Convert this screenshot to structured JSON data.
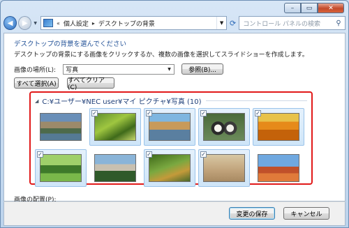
{
  "nav": {
    "address": [
      "個人設定",
      "デスクトップの背景"
    ],
    "address_prefix": "«",
    "search_placeholder": "コントロール パネルの検索"
  },
  "content": {
    "heading": "デスクトップの背景を選んでください",
    "description": "デスクトップの背景にする画像をクリックするか、複数の画像を選択してスライドショーを作成します。",
    "location_label": "画像の場所(L):",
    "location_value": "写真",
    "browse_label": "参照(B)...",
    "select_all_label": "すべて選択(A)",
    "clear_all_label": "すべてクリア(C)",
    "gallery": {
      "group_title": "C:¥ユーザー¥NEC user¥マイ ピクチャ¥写真 (10)",
      "images": [
        {
          "name": "canal-town",
          "checked": false
        },
        {
          "name": "green-leaves",
          "checked": true
        },
        {
          "name": "harbor-buildings",
          "checked": true
        },
        {
          "name": "ducklings",
          "checked": true
        },
        {
          "name": "tulip-field",
          "checked": true
        },
        {
          "name": "green-park",
          "checked": true
        },
        {
          "name": "castle",
          "checked": false
        },
        {
          "name": "forest-path",
          "checked": true
        },
        {
          "name": "sand-snail",
          "checked": true
        },
        {
          "name": "red-desert",
          "checked": false
        }
      ]
    },
    "arrange_label": "画像の配置(P):"
  },
  "footer": {
    "save_label": "変更の保存",
    "cancel_label": "キャンセル"
  },
  "colors": {
    "highlight_border": "#e11919",
    "heading": "#1f4f96"
  }
}
